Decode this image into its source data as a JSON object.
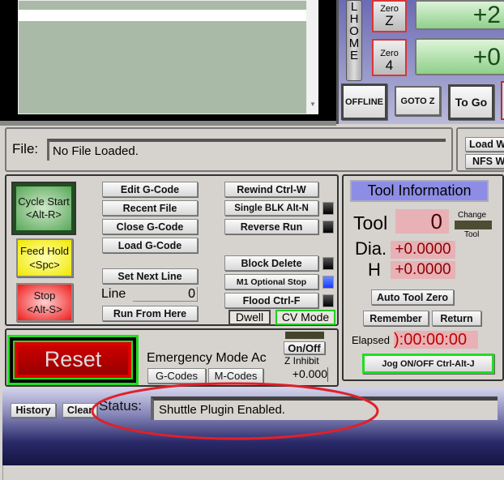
{
  "gcode_window": {
    "scroll_icon": "scroll-down-arrow"
  },
  "home": {
    "label": "L\nH\nO\nM\nE"
  },
  "zero_buttons": [
    {
      "top": "Zero",
      "axis": "Z"
    },
    {
      "top": "Zero",
      "axis": "4"
    }
  ],
  "dro": [
    "+2",
    "+0"
  ],
  "mode_buttons": [
    "OFFLINE",
    "GOTO Z",
    "To Go"
  ],
  "file": {
    "label": "File:",
    "value": "No File Loaded."
  },
  "wizard_buttons": [
    "Load W",
    "NFS W"
  ],
  "program": {
    "cycle_start": "Cycle Start\n<Alt-R>",
    "feed_hold": "Feed Hold\n<Spc>",
    "stop": "Stop\n<Alt-S>",
    "edit": "Edit G-Code",
    "recent": "Recent File",
    "close": "Close G-Code",
    "load": "Load G-Code",
    "set_next": "Set Next Line",
    "line_label": "Line",
    "line_value": "0",
    "run_from": "Run From Here",
    "rewind": "Rewind Ctrl-W",
    "single": "Single BLK Alt-N",
    "reverse": "Reverse Run",
    "block_delete": "Block Delete",
    "m1": "M1 Optional Stop",
    "flood": "Flood Ctrl-F",
    "dwell": "Dwell",
    "cv": "CV Mode",
    "led_on_color": "#1a3cff"
  },
  "tool": {
    "title": "Tool Information",
    "tool_label": "Tool",
    "tool_value": "0",
    "change_top": "Change",
    "change_bottom": "Tool",
    "dia_label": "Dia.",
    "dia_value": "+0.0000",
    "h_label": "H",
    "h_value": "+0.0000",
    "auto_zero": "Auto Tool Zero",
    "remember": "Remember",
    "return": "Return",
    "elapsed_label": "Elapsed",
    "elapsed_value": "):00:00:00",
    "jog": "Jog ON/OFF Ctrl-Alt-J"
  },
  "reset": {
    "label": "Reset",
    "emergency": "Emergency Mode Ac",
    "gcodes": "G-Codes",
    "mcodes": "M-Codes",
    "onoff": "On/Off",
    "zinhibit": "Z Inhibit",
    "zvalue": "+0.000"
  },
  "status": {
    "history": "History",
    "clear": "Clear",
    "label": "Status:",
    "value": "Shuttle Plugin Enabled.",
    "highlight_color": "#e0202a"
  }
}
